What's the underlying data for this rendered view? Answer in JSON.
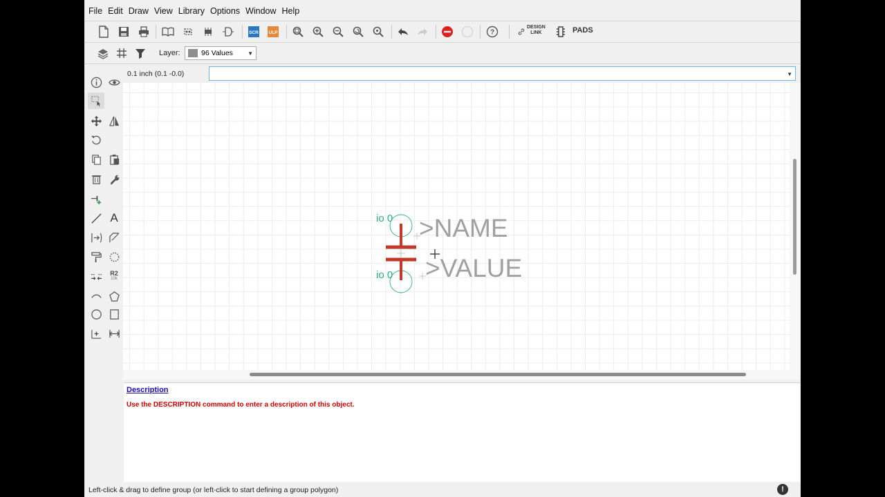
{
  "menu": [
    "File",
    "Edit",
    "Draw",
    "View",
    "Library",
    "Options",
    "Window",
    "Help"
  ],
  "toolbar": {
    "scr_label": "SCR",
    "ulp_label": "ULP",
    "design_link_line1": "DESIGN",
    "design_link_line2": "LINK",
    "pads_label": "PADS"
  },
  "layer": {
    "label": "Layer:",
    "selected": "96 Values",
    "swatch_color": "#8e8e8e"
  },
  "coordinates": "0.1 inch (0.1 -0.0)",
  "command_input": {
    "value": ""
  },
  "symbol": {
    "pin_top": "io 0",
    "pin_bottom": "io 0",
    "name_text": ">NAME",
    "value_text": ">VALUE",
    "body_color": "#c0392b",
    "pin_color": "#2ab27b",
    "text_color": "#a0a0a0"
  },
  "description": {
    "title": "Description",
    "text": "Use the DESCRIPTION command to enter a description of this object."
  },
  "status": {
    "message": "Left-click & drag to define group (or left-click to start defining a group polygon)",
    "icon": "!"
  },
  "sidebar": {
    "text_tool": "A",
    "r2_label": "R2",
    "r2_sub": "10k"
  }
}
